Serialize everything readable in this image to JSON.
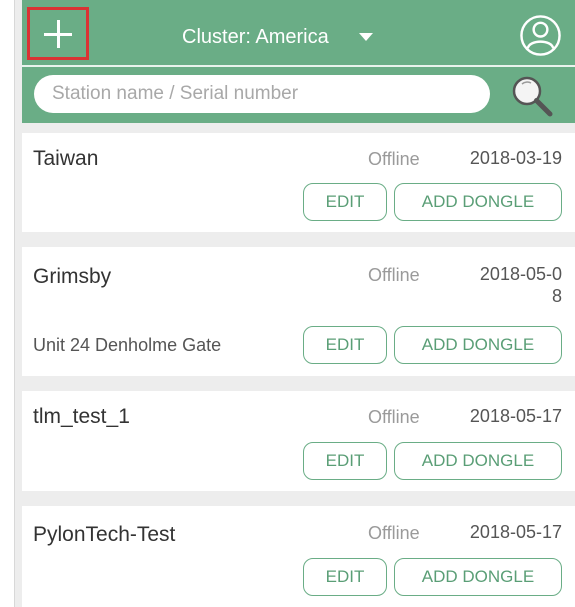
{
  "header": {
    "cluster_label": "Cluster: America"
  },
  "search": {
    "placeholder": "Station name / Serial number"
  },
  "stations": [
    {
      "name": "Taiwan",
      "status": "Offline",
      "date": "2018-03-19",
      "address": "",
      "edit_label": "EDIT",
      "add_dongle_label": "ADD DONGLE"
    },
    {
      "name": "Grimsby",
      "status": "Offline",
      "date_line1": "2018-05-0",
      "date_line2": "8",
      "address": "Unit 24 Denholme Gate",
      "edit_label": "EDIT",
      "add_dongle_label": "ADD DONGLE"
    },
    {
      "name": "tlm_test_1",
      "status": "Offline",
      "date": "2018-05-17",
      "address": "",
      "edit_label": "EDIT",
      "add_dongle_label": "ADD DONGLE"
    },
    {
      "name": "PylonTech-Test",
      "status": "Offline",
      "date": "2018-05-17",
      "address": "",
      "edit_label": "EDIT",
      "add_dongle_label": "ADD DONGLE"
    }
  ],
  "colors": {
    "header_green": "#6aad86",
    "highlight_red": "#d93434",
    "button_text_green": "#5a9e76"
  }
}
